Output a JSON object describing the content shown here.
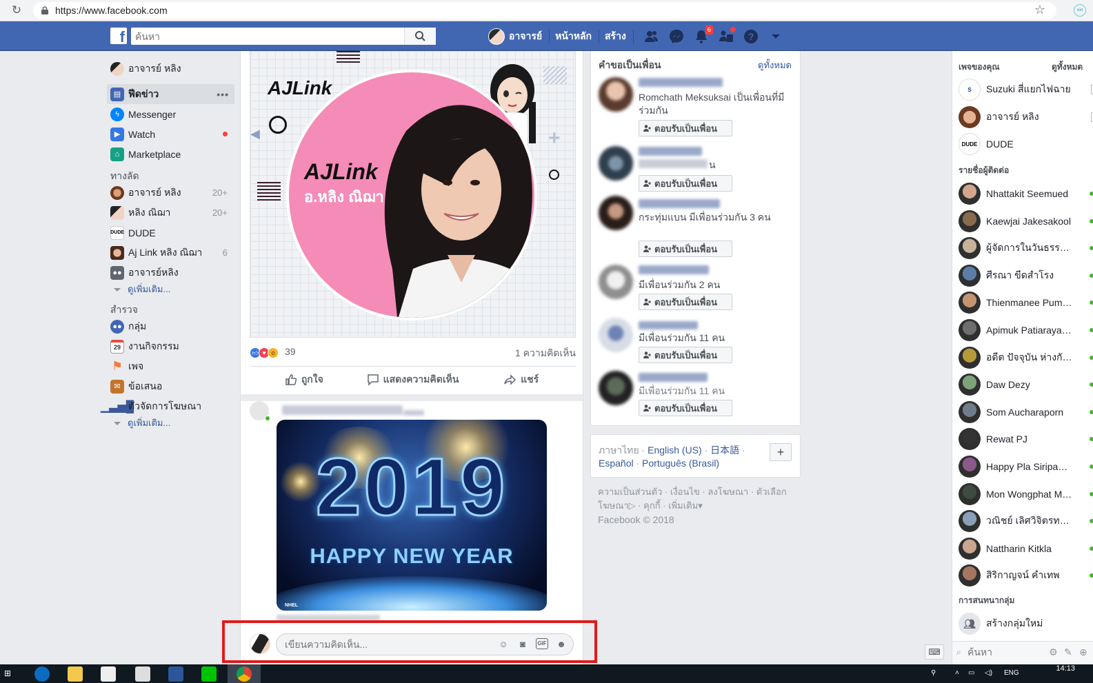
{
  "browser": {
    "url": "https://www.facebook.com"
  },
  "header": {
    "search_placeholder": "ค้นหา",
    "profile_name": "อาจารย์",
    "home_label": "หน้าหลัก",
    "create_label": "สร้าง",
    "notification_count": "6",
    "brand_color": "#4267b2"
  },
  "left_nav": {
    "user": "อาจารย์ หลิง",
    "main_items": [
      {
        "label": "ฟีดข่าว",
        "icon": "news-feed-icon"
      },
      {
        "label": "Messenger",
        "icon": "messenger-icon"
      },
      {
        "label": "Watch",
        "icon": "watch-icon"
      },
      {
        "label": "Marketplace",
        "icon": "marketplace-icon"
      }
    ],
    "shortcuts_title": "ทางลัด",
    "shortcuts": [
      {
        "label": "อาจารย์ หลิง",
        "count": "20+"
      },
      {
        "label": "หลิง ณิฌา",
        "count": "20+"
      },
      {
        "label": "DUDE",
        "count": ""
      },
      {
        "label": "Aj Link หลิง ณิฌา",
        "count": "6"
      },
      {
        "label": "อาจารย์หลิง",
        "count": ""
      }
    ],
    "see_more_1": "ดูเพิ่มเติม...",
    "explore_title": "สำรวจ",
    "explore": [
      {
        "label": "กลุ่ม",
        "icon": "groups-icon"
      },
      {
        "label": "งานกิจกรรม",
        "icon": "calendar-icon"
      },
      {
        "label": "เพจ",
        "icon": "flag-icon"
      },
      {
        "label": "ข้อเสนอ",
        "icon": "offers-icon"
      },
      {
        "label": "ตัวจัดการโฆษณา",
        "icon": "ads-manager-icon"
      }
    ],
    "see_more_2": "ดูเพิ่มเติม...",
    "calendar_day": "29"
  },
  "post1": {
    "banner_logo": "AJLink",
    "circle_logo": "AJLink",
    "circle_subtitle": "อ.หลิง ณิฌา",
    "reaction_count": "39",
    "comment_count": "1 ความคิดเห็น",
    "like_label": "ถูกใจ",
    "comment_label": "แสดงความคิดเห็น",
    "share_label": "แชร์"
  },
  "post2": {
    "image_year": "2019",
    "image_text": "HAPPY NEW YEAR",
    "image_mark": "NHEL"
  },
  "comment_box": {
    "placeholder": "เขียนความคิดเห็น..."
  },
  "friend_requests": {
    "title": "คำขอเป็นเพื่อน",
    "see_all": "ดูทั้งหมด",
    "items": [
      {
        "text": "Romchath Meksuksai เป็นเพื่อนที่มีร่วมกัน"
      },
      {
        "text": "น"
      },
      {
        "text": "กระทุ่มแบน มีเพื่อนร่วมกัน 3 คน"
      },
      {
        "text": "มีเพื่อนร่วมกัน 2 คน"
      },
      {
        "text": "มีเพื่อนร่วมกัน 11 คน"
      },
      {
        "text": "มีเพื่อนร่วมกัน 11 คน"
      }
    ],
    "confirm_label": "ตอบรับเป็นเพื่อน"
  },
  "languages": {
    "current": "ภาษาไทย",
    "options": [
      "English (US)",
      "日本語",
      "Español",
      "Português (Brasil)"
    ],
    "add": "+"
  },
  "footer": {
    "links": [
      "ความเป็นส่วนตัว",
      "เงื่อนไข",
      "ลงโฆษณา",
      "ตัวเลือกโฆษณา",
      "คุกกี้",
      "เพิ่มเติม"
    ],
    "copyright": "Facebook © 2018"
  },
  "right_sidebar": {
    "pages_title": "เพจของคุณ",
    "pages_title2": "ดูทั้งหมด",
    "pages": [
      {
        "name": "Suzuki สี่แยกไฟฉาย",
        "box": "4"
      },
      {
        "name": "อาจารย์ หลิง",
        "box": "5"
      },
      {
        "name": "DUDE",
        "box": ""
      }
    ],
    "contacts_title": "รายชื่อผู้ติดต่อ",
    "contacts": [
      "Nhattakit Seemued",
      "Kaewjai Jakesakool",
      "ผู้จัดการในวันธรรมดา",
      "ศีรณา ขีดสำโรง",
      "Thienmanee Pumsawai",
      "Apimuk Patiarayakul",
      "อดีต ปัจจุบัน ห่างกันเพียงนิด",
      "Daw Dezy",
      "Som Aucharaporn",
      "Rewat PJ",
      "Happy Pla Siripanya",
      "Mon Wongphat Mena",
      "วณิชย์ เลิศวิจิตรทรัพย์",
      "Nattharin Kitkla",
      "สิริกาญจน์ คำเทพ"
    ],
    "groups_title": "การสนทนากลุ่ม",
    "create_group": "สร้างกลุ่มใหม่",
    "search_placeholder": "ค้นหา"
  },
  "taskbar": {
    "time": "14:13",
    "lang": "ENG"
  }
}
